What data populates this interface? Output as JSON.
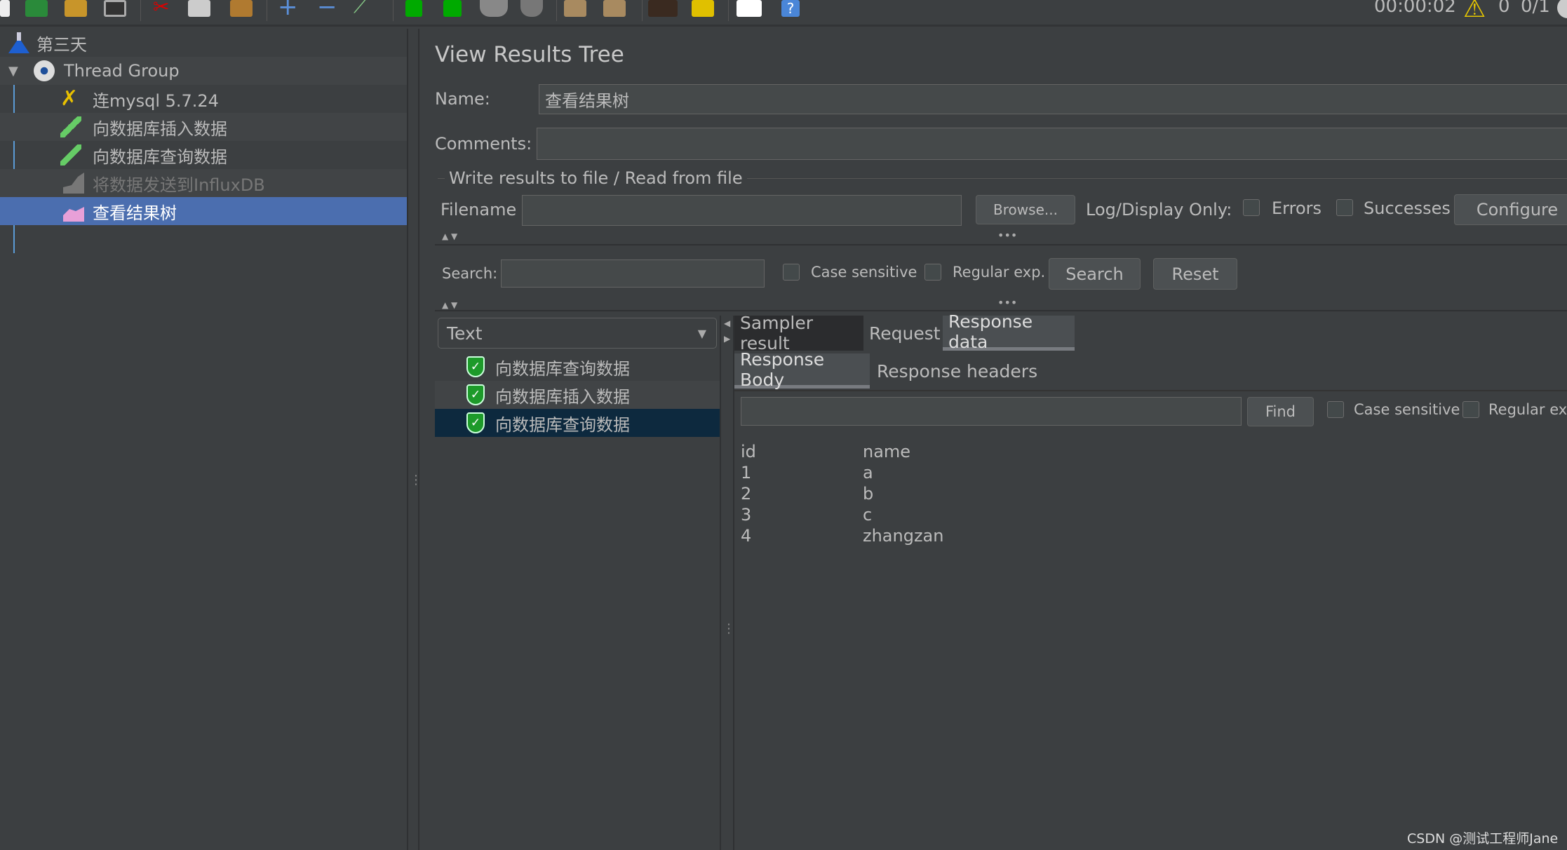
{
  "toolbar": {
    "timer": "00:00:02",
    "warnings": "0",
    "threads": "0/1",
    "icons": [
      "new-icon",
      "templates-icon",
      "open-icon",
      "save-icon",
      "cut-icon",
      "copy-icon",
      "paste-icon",
      "expand-icon",
      "collapse-icon",
      "toggle-icon",
      "start-icon",
      "start-no-pause-icon",
      "stop-icon",
      "shutdown-icon",
      "clear-icon",
      "clear-all-icon",
      "search-icon",
      "reset-search-icon",
      "function-helper-icon",
      "help-icon"
    ]
  },
  "tree": {
    "items": [
      {
        "label": "第三天",
        "icon": "test-plan-flask-icon"
      },
      {
        "label": "Thread Group",
        "icon": "thread-group-gear-icon"
      },
      {
        "label": "连mysql 5.7.24",
        "icon": "config-tools-icon"
      },
      {
        "label": "向数据库插入数据",
        "icon": "sampler-pipette-icon"
      },
      {
        "label": "向数据库查询数据",
        "icon": "sampler-pipette-icon"
      },
      {
        "label": "将数据发送到InfluxDB",
        "icon": "listener-graph-icon",
        "disabled": true
      },
      {
        "label": "查看结果树",
        "icon": "results-tree-icon",
        "selected": true
      }
    ]
  },
  "panel": {
    "title": "View Results Tree",
    "name_label": "Name:",
    "name_value": "查看结果树",
    "comments_label": "Comments:",
    "comments_value": "",
    "file_section": "Write results to file / Read from file",
    "filename_label": "Filename",
    "filename_value": "",
    "browse": "Browse...",
    "log_display": "Log/Display Only:",
    "errors": "Errors",
    "successes": "Successes",
    "configure": "Configure",
    "search_label": "Search:",
    "search_value": "",
    "case_sensitive": "Case sensitive",
    "regex": "Regular exp.",
    "search_btn": "Search",
    "reset_btn": "Reset"
  },
  "results": {
    "renderer": "Text",
    "samples": [
      {
        "label": "向数据库查询数据",
        "status": "success"
      },
      {
        "label": "向数据库插入数据",
        "status": "success"
      },
      {
        "label": "向数据库查询数据",
        "status": "success",
        "selected": true
      }
    ],
    "tabs": [
      "Sampler result",
      "Request",
      "Response data"
    ],
    "active_tab": "Response data",
    "subtabs": [
      "Response Body",
      "Response headers"
    ],
    "active_subtab": "Response Body",
    "find_value": "",
    "find_btn": "Find",
    "case_sensitive": "Case sensitive",
    "regex": "Regular exp",
    "body": {
      "headers": [
        "id",
        "name"
      ],
      "rows": [
        [
          "1",
          "a"
        ],
        [
          "2",
          "b"
        ],
        [
          "3",
          "c"
        ],
        [
          "4",
          "zhangzan"
        ]
      ]
    }
  },
  "watermark": "CSDN @测试工程师Jane"
}
